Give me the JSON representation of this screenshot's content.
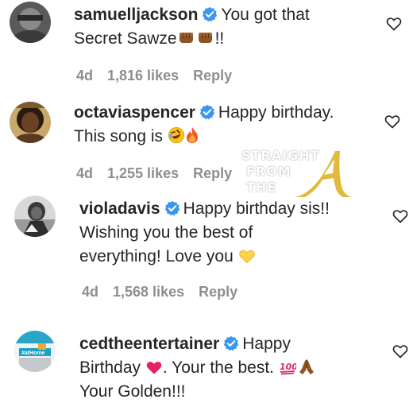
{
  "comments": [
    {
      "username": "samuelljackson",
      "line1": "You got that",
      "line2": "Secret Sawze✊🏾✊🏾!!",
      "line2_prefix": "Secret Sawze",
      "line2_suffix": "!!",
      "time": "4d",
      "likes": "1,816 likes",
      "reply": "Reply"
    },
    {
      "username": "octaviaspencer",
      "line1": "Happy birthday.",
      "line2_prefix": "This song is ",
      "time": "4d",
      "likes": "1,255 likes",
      "reply": "Reply"
    },
    {
      "username": "violadavis",
      "line1": "Happy birthday sis!!",
      "line2": "Wishing you the best of",
      "line3_prefix": "everything! Love you ",
      "time": "4d",
      "likes": "1,568 likes",
      "reply": "Reply"
    },
    {
      "username": "cedtheentertainer",
      "line1": "Happy",
      "line2_prefix": "Birthday ",
      "line2_suffix": ". Your the best. ",
      "line3": "Your Golden!!!"
    }
  ],
  "watermark": {
    "line1": "STRAIGHT",
    "line2": "FROM",
    "line3": "THE",
    "letter": "A"
  },
  "colors": {
    "text": "#262626",
    "meta": "#8e8e8e",
    "verified": "#3897f0",
    "heart_outline": "#262626",
    "watermark_gold": "#e2b93b"
  },
  "icons": {
    "verified": "verified-badge-icon",
    "like": "heart-outline-icon"
  }
}
